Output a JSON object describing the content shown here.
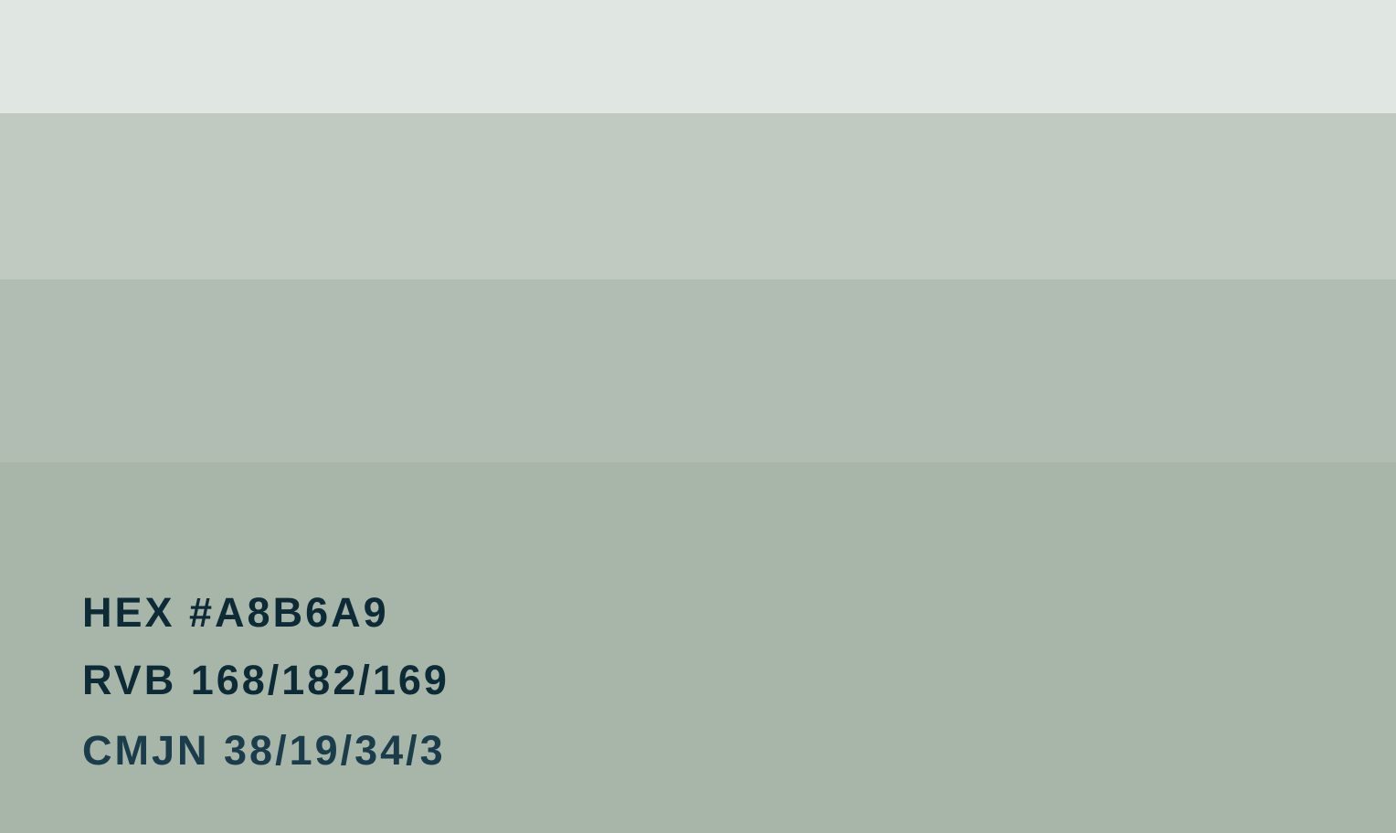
{
  "swatches": {
    "tint_1": "#E0E6E2",
    "tint_2": "#C0CAC1",
    "tint_3": "#B1BDB3",
    "base": "#A8B6A9"
  },
  "color_codes": {
    "hex": "HEX #A8B6A9",
    "rvb": "RVB 168/182/169",
    "cmjn": "CMJN 38/19/34/3"
  },
  "text_colors": {
    "primary": "#0D2B36",
    "secondary": "#1A3C4B"
  }
}
